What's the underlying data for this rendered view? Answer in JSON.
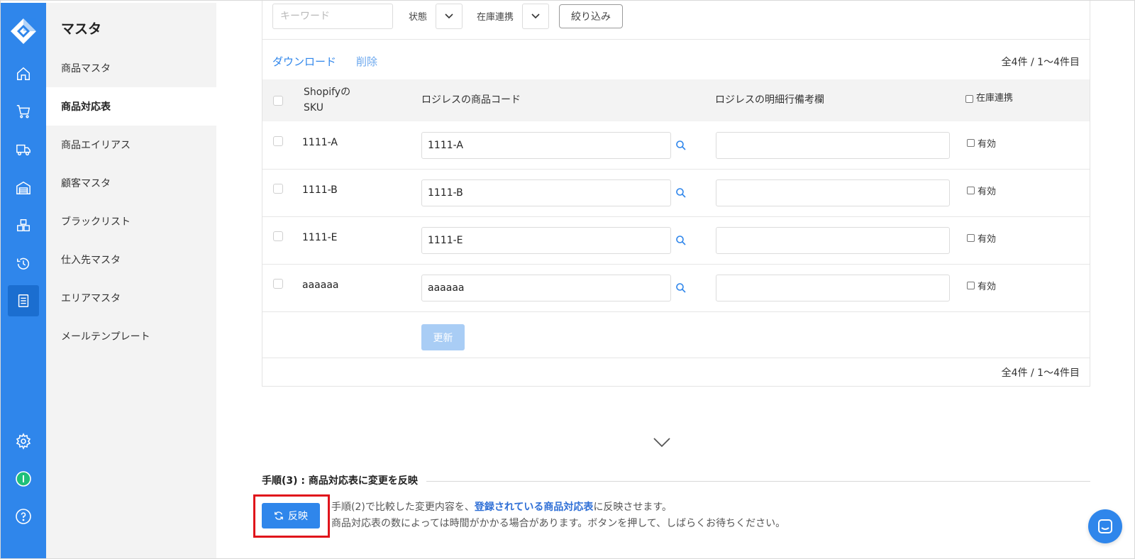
{
  "sidebar": {
    "title": "マスタ",
    "items": [
      {
        "label": "商品マスタ"
      },
      {
        "label": "商品対応表"
      },
      {
        "label": "商品エイリアス"
      },
      {
        "label": "顧客マスタ"
      },
      {
        "label": "ブラックリスト"
      },
      {
        "label": "仕入先マスタ"
      },
      {
        "label": "エリアマスタ"
      },
      {
        "label": "メールテンプレート"
      }
    ]
  },
  "rail_icons": [
    "home-icon",
    "cart-icon",
    "truck-icon",
    "warehouse-icon",
    "boxes-icon",
    "history-icon",
    "list-icon",
    "gear-icon",
    "status-icon",
    "help-icon"
  ],
  "filters": {
    "keyword_placeholder": "キーワード",
    "status_label": "状態",
    "stock_label": "在庫連携",
    "filter_button": "絞り込み"
  },
  "actions": {
    "download": "ダウンロード",
    "delete": "削除",
    "count_top": "全4件 / 1〜4件目",
    "count_bottom": "全4件 / 1〜4件目"
  },
  "table": {
    "headers": {
      "sku_line1": "Shopifyの",
      "sku_line2": "SKU",
      "code": "ロジレスの商品コード",
      "memo": "ロジレスの明細行備考欄",
      "stock": "在庫連携"
    },
    "rows": [
      {
        "sku": "1111-A",
        "code": "1111-A",
        "memo": "",
        "valid_label": "有効"
      },
      {
        "sku": "1111-B",
        "code": "1111-B",
        "memo": "",
        "valid_label": "有効"
      },
      {
        "sku": "1111-E",
        "code": "1111-E",
        "memo": "",
        "valid_label": "有効"
      },
      {
        "sku": "aaaaaa",
        "code": "aaaaaa",
        "memo": "",
        "valid_label": "有効"
      }
    ],
    "update_button": "更新"
  },
  "step3": {
    "title": "手順(3) : 商品対応表に変更を反映",
    "button": "反映",
    "desc_prefix": "手順(2)で比較した変更内容を、",
    "desc_link": "登録されている商品対応表",
    "desc_suffix": "に反映させます。",
    "desc_line2": "商品対応表の数によっては時間がかかる場合があります。ボタンを押して、しばらくお待ちください。"
  },
  "colors": {
    "primary": "#2f86eb",
    "rail": "#2f86eb",
    "highlight": "#e0141b",
    "disabled_button": "#a9cdf5"
  }
}
